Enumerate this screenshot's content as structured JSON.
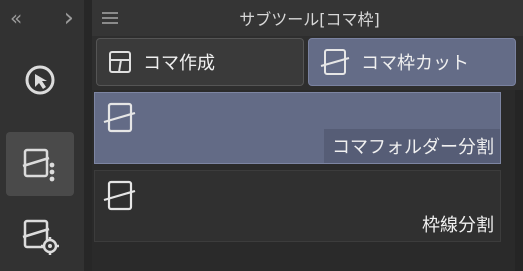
{
  "rail": {
    "collapse_icon": "double-chevron-left-icon",
    "expand_icon": "chevron-right-icon",
    "collapse_glyph": "«",
    "expand_glyph": "›",
    "buttons": [
      {
        "icon": "object-select-icon"
      },
      {
        "icon": "frame-cut-tool-icon",
        "active": true
      },
      {
        "icon": "frame-settings-icon"
      }
    ]
  },
  "header": {
    "menu_icon": "hamburger-menu-icon",
    "title": "サブツール[コマ枠]"
  },
  "tools": [
    {
      "label": "コマ作成",
      "icon": "panel-create-icon",
      "selected": false
    },
    {
      "label": "コマ枠カット",
      "icon": "panel-cut-icon",
      "selected": true
    }
  ],
  "subtools": [
    {
      "label": "コマフォルダー分割",
      "icon": "panel-slash-icon",
      "selected": true
    },
    {
      "label": "枠線分割",
      "icon": "panel-slash-icon",
      "selected": false
    }
  ],
  "colors": {
    "accent": "#636b86",
    "panel": "#2b2b2b"
  }
}
